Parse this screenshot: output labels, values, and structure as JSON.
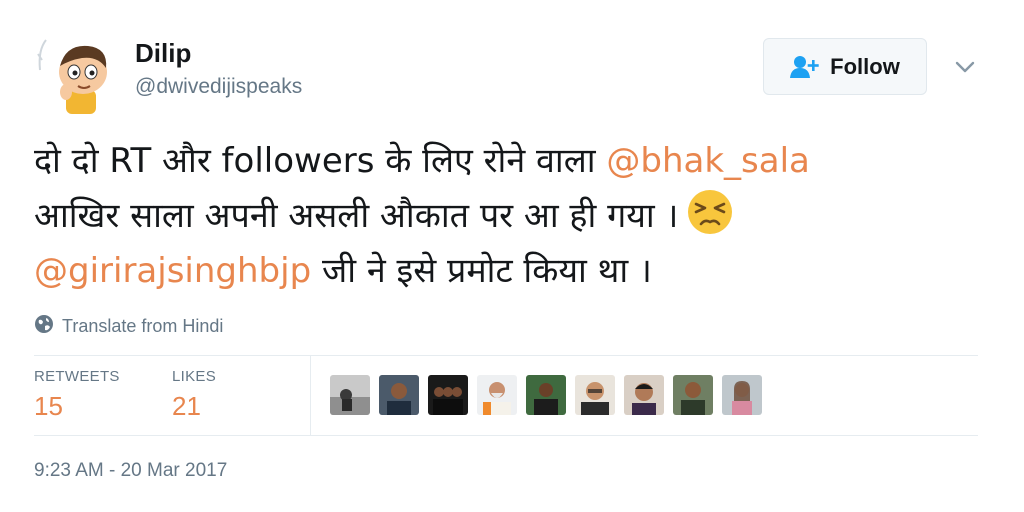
{
  "user": {
    "name": "Dilip",
    "handle": "@dwivedijispeaks",
    "avatar_icon": "cartoon-boy-avatar"
  },
  "follow_button": {
    "label": "Follow",
    "icon": "add-user-icon"
  },
  "menu": {
    "icon": "chevron-down-icon"
  },
  "tweet": {
    "line1_text": "दो दो RT और followers के लिए रोने वाला ",
    "line1_mention": "@bhak_sala",
    "line2_text": "आखिर साला अपनी असली औकात पर आ ही गया ।",
    "line2_emoji": "persevering-face-emoji",
    "line3_mention": "@girirajsinghbjp",
    "line3_text": " जी ने इसे प्रमोट किया था ।"
  },
  "translate": {
    "label": "Translate from Hindi",
    "icon": "globe-icon"
  },
  "stats": {
    "retweets_label": "RETWEETS",
    "retweets_value": "15",
    "likes_label": "LIKES",
    "likes_value": "21"
  },
  "liked_by_avatars": [
    "liker-avatar-1",
    "liker-avatar-2",
    "liker-avatar-3",
    "liker-avatar-4",
    "liker-avatar-5",
    "liker-avatar-6",
    "liker-avatar-7",
    "liker-avatar-8",
    "liker-avatar-9"
  ],
  "timestamp": "9:23 AM - 20 Mar 2017",
  "colors": {
    "mention": "#e8864e",
    "count": "#e8864e",
    "secondary_text": "#657786",
    "follow_icon": "#1da1f2"
  }
}
